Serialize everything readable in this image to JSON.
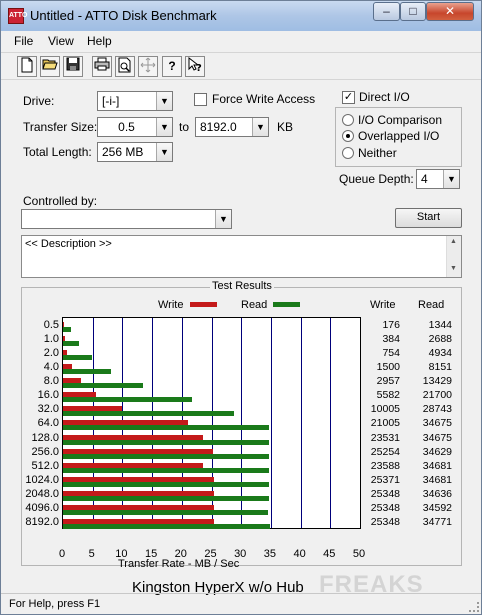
{
  "window": {
    "title": "Untitled - ATTO Disk Benchmark",
    "minimize": "–",
    "maximize": "□",
    "close": "✕"
  },
  "menu": [
    "File",
    "View",
    "Help"
  ],
  "toolbar": [
    "new-icon",
    "open-icon",
    "save-icon",
    "print-icon",
    "print-preview-icon",
    "move-icon",
    "help-icon",
    "context-help-icon"
  ],
  "settings": {
    "drive_label": "Drive:",
    "drive_value": "[-i-]",
    "transfer_size_label": "Transfer Size:",
    "transfer_from": "0.5",
    "to_label": "to",
    "transfer_to": "8192.0",
    "kb_label": "KB",
    "total_length_label": "Total Length:",
    "total_length_value": "256 MB",
    "force_write_access_label": "Force Write Access",
    "force_write_access_checked": false,
    "direct_io_label": "Direct I/O",
    "direct_io_checked": true,
    "io_comparison_label": "I/O Comparison",
    "overlapped_io_label": "Overlapped I/O",
    "neither_label": "Neither",
    "selected_mode": "overlapped",
    "queue_depth_label": "Queue Depth:",
    "queue_depth_value": "4",
    "controlled_by_label": "Controlled by:",
    "controlled_by_value": "",
    "start_label": "Start",
    "description": "<< Description >>"
  },
  "results": {
    "group_title": "Test Results",
    "write_legend": "Write",
    "read_legend": "Read",
    "write_color": "#c41a1a",
    "read_color": "#1a7a1a",
    "write_col_header": "Write",
    "read_col_header": "Read"
  },
  "chart_data": {
    "type": "bar",
    "orientation": "horizontal",
    "categories": [
      "0.5",
      "1.0",
      "2.0",
      "4.0",
      "8.0",
      "16.0",
      "32.0",
      "64.0",
      "128.0",
      "256.0",
      "512.0",
      "1024.0",
      "2048.0",
      "4096.0",
      "8192.0"
    ],
    "series": [
      {
        "name": "Write",
        "values": [
          176,
          384,
          754,
          1500,
          2957,
          5582,
          10005,
          21005,
          23531,
          25254,
          23588,
          25371,
          25348,
          25348,
          25348
        ]
      },
      {
        "name": "Read",
        "values": [
          1344,
          2688,
          4934,
          8151,
          13429,
          21700,
          28743,
          34675,
          34675,
          34629,
          34681,
          34681,
          34636,
          34592,
          34771
        ]
      }
    ],
    "xlabel": "Transfer Rate - MB / Sec",
    "xticks": [
      "0",
      "5",
      "10",
      "15",
      "20",
      "25",
      "30",
      "35",
      "40",
      "45",
      "50"
    ],
    "xlim": [
      0,
      50
    ],
    "grid": true,
    "legend": "top"
  },
  "caption": "Kingston HyperX w/o Hub",
  "watermark": "FREAKS",
  "status": "For Help, press F1"
}
